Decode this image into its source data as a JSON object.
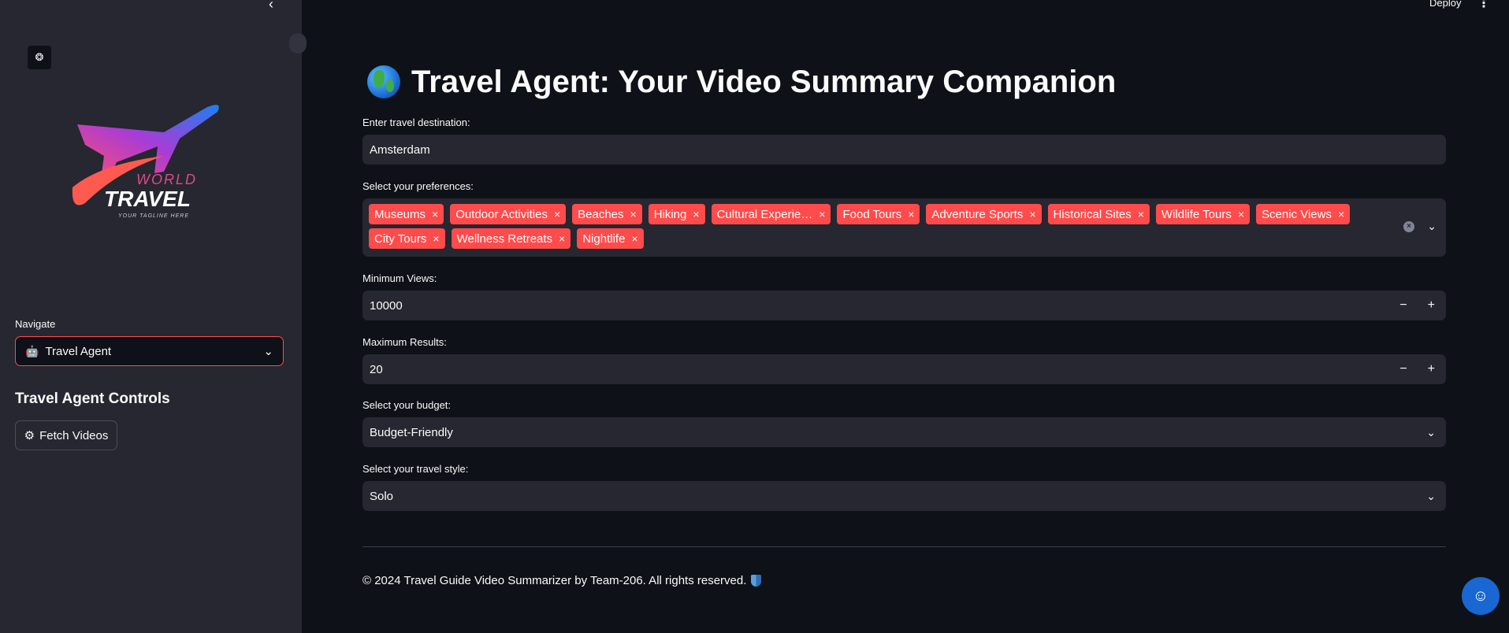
{
  "sidebar": {
    "collapse_icon": "‹",
    "brand_top": "WORLD",
    "brand_main": "TRAVEL",
    "brand_tagline": "YOUR TAGLINE HERE",
    "navigate_label": "Navigate",
    "navigate_value": "Travel Agent",
    "controls_title": "Travel Agent Controls",
    "fetch_label": "Fetch Videos"
  },
  "topbar": {
    "deploy": "Deploy",
    "menu_icon": "⋮"
  },
  "main": {
    "title": "Travel Agent: Your Video Summary Companion",
    "destination_label": "Enter travel destination:",
    "destination_value": "Amsterdam",
    "preferences_label": "Select your preferences:",
    "preferences_row1": [
      "Museums",
      "Outdoor Activities",
      "Beaches",
      "Hiking",
      "Cultural Experie…",
      "Food Tours",
      "Adventure Sports",
      "Historical Sites",
      "Wildlife Tours",
      "Scenic Views"
    ],
    "preferences_row2": [
      "City Tours",
      "Wellness Retreats",
      "Nightlife"
    ],
    "min_views_label": "Minimum Views:",
    "min_views_value": "10000",
    "max_results_label": "Maximum Results:",
    "max_results_value": "20",
    "budget_label": "Select your budget:",
    "budget_value": "Budget-Friendly",
    "style_label": "Select your travel style:",
    "style_value": "Solo",
    "stepper_minus": "−",
    "stepper_plus": "+",
    "footer": "© 2024 Travel Guide Video Summarizer by Team-206. All rights reserved."
  },
  "colors": {
    "accent": "#ff4b4b",
    "background": "#0e1117",
    "sidebar": "#262730",
    "chat": "#1967d2"
  }
}
